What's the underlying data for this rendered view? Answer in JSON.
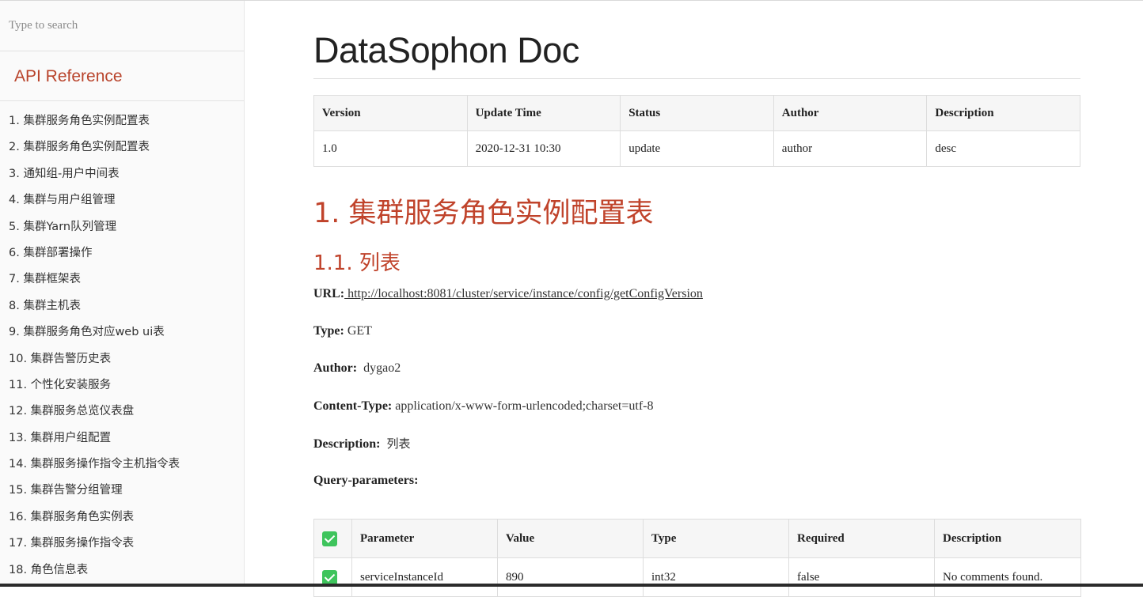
{
  "sidebar": {
    "search_placeholder": "Type to search",
    "heading": "API Reference",
    "items": [
      {
        "label": "1. 集群服务角色实例配置表"
      },
      {
        "label": "2. 集群服务角色实例配置表"
      },
      {
        "label": "3. 通知组-用户中间表"
      },
      {
        "label": "4. 集群与用户组管理"
      },
      {
        "label": "5. 集群Yarn队列管理"
      },
      {
        "label": "6. 集群部署操作"
      },
      {
        "label": "7. 集群框架表"
      },
      {
        "label": "8. 集群主机表"
      },
      {
        "label": "9. 集群服务角色对应web ui表"
      },
      {
        "label": "10. 集群告警历史表"
      },
      {
        "label": "11. 个性化安装服务"
      },
      {
        "label": "12. 集群服务总览仪表盘"
      },
      {
        "label": "13. 集群用户组配置"
      },
      {
        "label": "14. 集群服务操作指令主机指令表"
      },
      {
        "label": "15. 集群告警分组管理"
      },
      {
        "label": "16. 集群服务角色实例表"
      },
      {
        "label": "17. 集群服务操作指令表"
      },
      {
        "label": "18. 角色信息表"
      }
    ]
  },
  "main": {
    "title": "DataSophon Doc",
    "version_table": {
      "headers": [
        "Version",
        "Update Time",
        "Status",
        "Author",
        "Description"
      ],
      "rows": [
        [
          "1.0",
          "2020-12-31 10:30",
          "update",
          "author",
          "desc"
        ]
      ]
    },
    "section_title": "1. 集群服务角色实例配置表",
    "subsection_title": "1.1. 列表",
    "url_label": "URL:",
    "url_value": " http://localhost:8081/cluster/service/instance/config/getConfigVersion",
    "type_label": "Type:",
    "type_value": "GET",
    "author_label": "Author:",
    "author_value": "dygao2",
    "content_type_label": "Content-Type:",
    "content_type_value": "application/x-www-form-urlencoded;charset=utf-8",
    "description_label": "Description:",
    "description_value": "列表",
    "query_params_label": "Query-parameters:",
    "params_table": {
      "headers": [
        "Parameter",
        "Value",
        "Type",
        "Required",
        "Description"
      ],
      "rows": [
        [
          "serviceInstanceId",
          "890",
          "int32",
          "false",
          "No comments found."
        ]
      ]
    }
  },
  "colors": {
    "accent": "#c0432b",
    "checkbox": "#3ec45c"
  },
  "icons": {
    "checkbox": "checkmark-icon"
  }
}
